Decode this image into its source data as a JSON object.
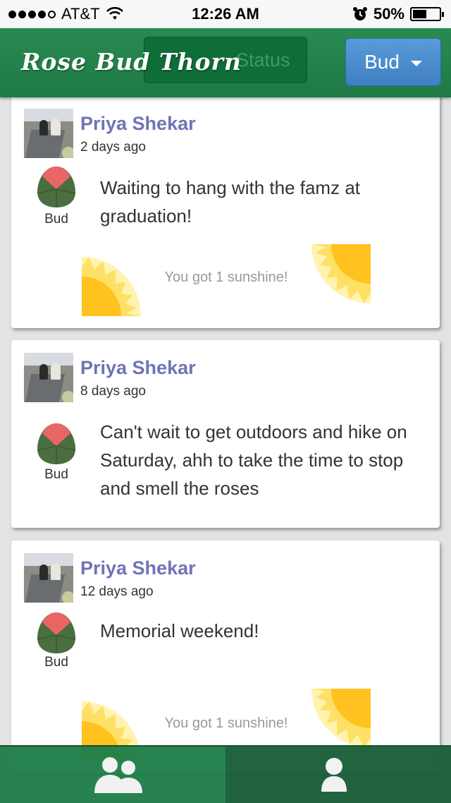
{
  "status_bar": {
    "carrier": "AT&T",
    "time": "12:26 AM",
    "battery": "50%",
    "battery_level": 0.5
  },
  "navbar": {
    "brand": "Rose Bud Thorn",
    "status_button": "Status",
    "filter_dropdown": "Bud"
  },
  "posts": [
    {
      "author": "Priya Shekar",
      "time_ago": "2 days ago",
      "category": "Bud",
      "text": "Waiting to hang with the famz at graduation!",
      "sunshine": "You got 1 sunshine!"
    },
    {
      "author": "Priya Shekar",
      "time_ago": "8 days ago",
      "category": "Bud",
      "text": "Can't wait to get outdoors and hike on Saturday, ahh to take the time to stop and smell the roses",
      "sunshine": ""
    },
    {
      "author": "Priya Shekar",
      "time_ago": "12 days ago",
      "category": "Bud",
      "text": "Memorial weekend!",
      "sunshine": "You got 1 sunshine!"
    }
  ],
  "tabbar": {
    "tabs": [
      {
        "icon": "group-icon",
        "active": false
      },
      {
        "icon": "person-icon",
        "active": true
      }
    ]
  },
  "colors": {
    "navbar_green": "#1e7a45",
    "dropdown_blue": "#4a8acb",
    "author_name": "#6f74b5",
    "bud_green": "#3d6b3a",
    "bud_pink": "#e86a6a"
  }
}
